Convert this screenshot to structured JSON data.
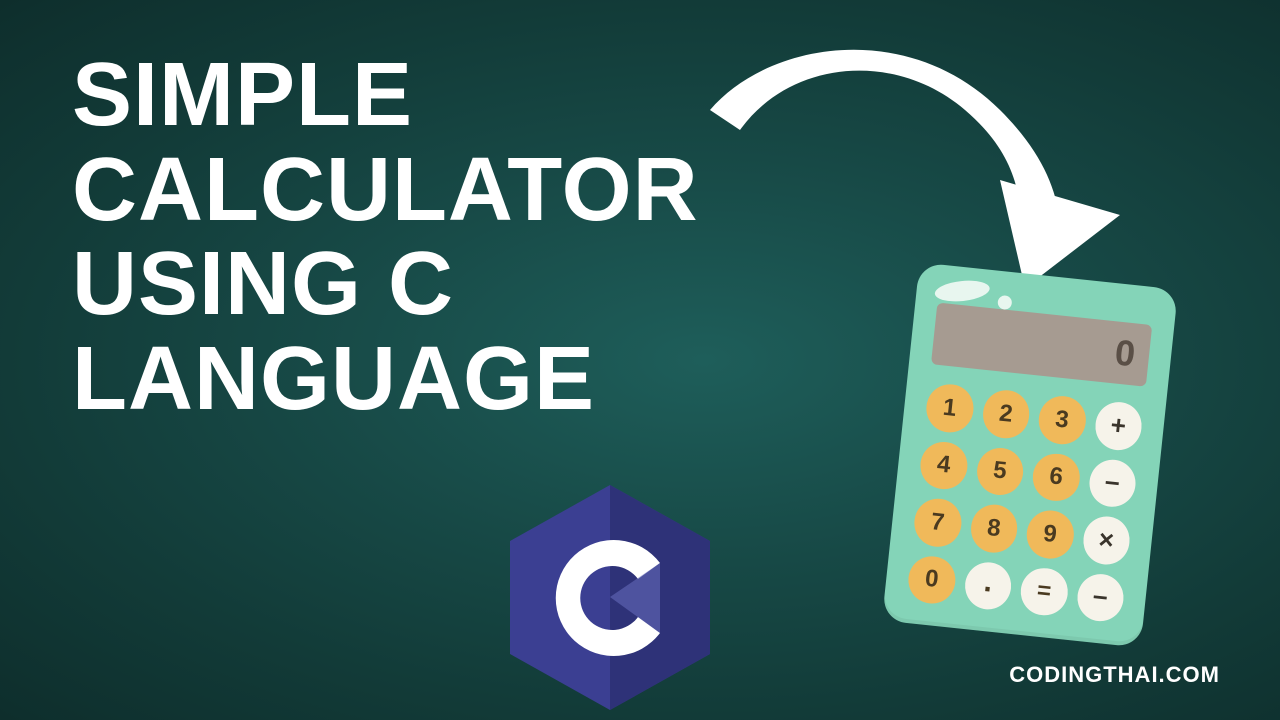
{
  "title": {
    "line1": "SIMPLE",
    "line2": "CALCULATOR",
    "line3": "USING C",
    "line4": "LANGUAGE"
  },
  "website": "CODINGTHAI.COM",
  "c_logo_letter": "C",
  "calculator": {
    "display": "0",
    "keys": {
      "r1": [
        "1",
        "2",
        "3",
        "+"
      ],
      "r2": [
        "4",
        "5",
        "6",
        "−"
      ],
      "r3": [
        "7",
        "8",
        "9",
        "×"
      ],
      "r4": [
        "0",
        ".",
        "=",
        "−"
      ]
    }
  }
}
